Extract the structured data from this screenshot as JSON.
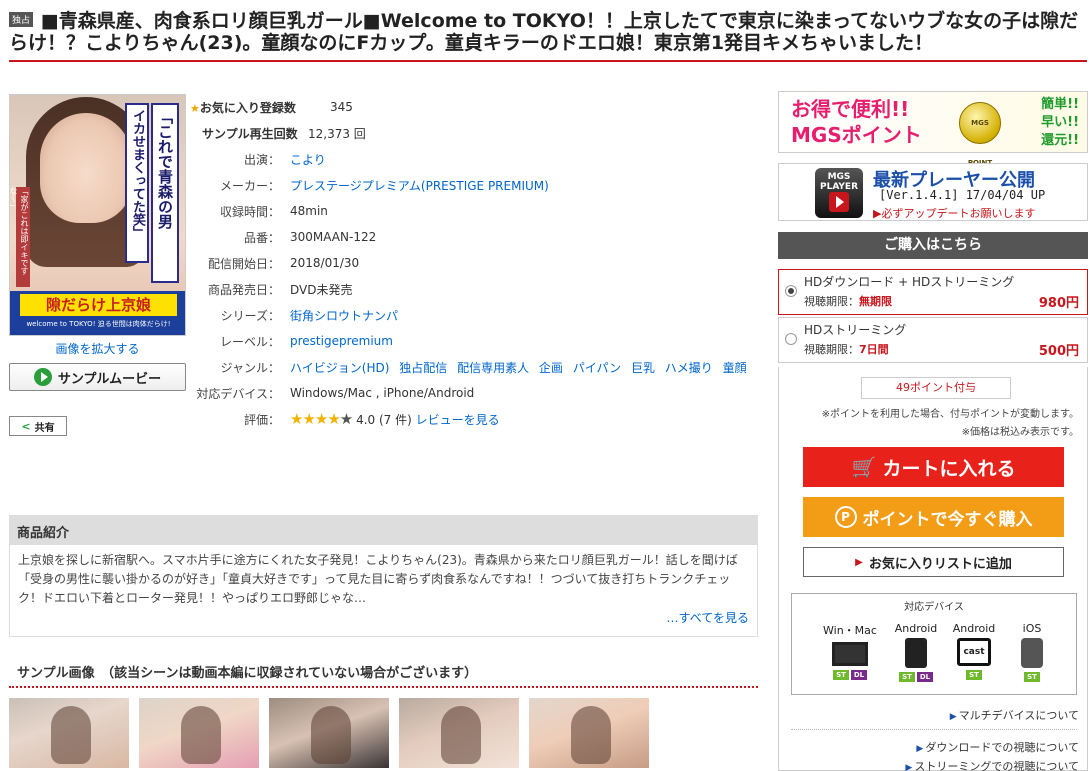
{
  "title": {
    "badge": "独占",
    "text": "■青森県産、肉食系ロリ顔巨乳ガール■Welcome to TOKYO！！上京したてで東京に染まってないウブな女の子は隙だらけ！？こよりちゃん(23)。童顔なのにFカップ。童貞キラーのドエロ娘！東京第1発目キメちゃいました！"
  },
  "cover": {
    "vertical_text_1": "「これで青森の男",
    "vertical_text_2": "イカせまくってた笑」",
    "side_text": "「家がこれは即イキですな〜」",
    "banner_big": "隙だらけ上京娘",
    "banner_small": "welcome to TOKYO! 迫る世間は肉体だらけ!"
  },
  "left": {
    "enlarge": "画像を拡大する",
    "sample_movie": "サンプルムービー",
    "share": "共有"
  },
  "info": {
    "favorites_label": "お気に入り登録数",
    "favorites_value": "345",
    "plays_label": "サンプル再生回数",
    "plays_value": "12,373 回",
    "rows": [
      {
        "label": "出演：",
        "value": "こより"
      },
      {
        "label": "メーカー：",
        "value": "プレステージプレミアム(PRESTIGE PREMIUM)"
      },
      {
        "label": "収録時間：",
        "value": "48min"
      },
      {
        "label": "品番：",
        "value": "300MAAN-122"
      },
      {
        "label": "配信開始日：",
        "value": "2018/01/30"
      },
      {
        "label": "商品発売日：",
        "value": "DVD未発売"
      },
      {
        "label": "シリーズ：",
        "value": "街角シロウトナンパ"
      },
      {
        "label": "レーベル：",
        "value": "prestigepremium"
      }
    ],
    "genre_label": "ジャンル：",
    "genres": [
      "ハイビジョン(HD)",
      "独占配信",
      "配信専用素人",
      "企画",
      "パイパン",
      "巨乳",
      "ハメ撮り",
      "童顔"
    ],
    "device_label": "対応デバイス：",
    "device_value": "Windows/Mac , iPhone/Android",
    "rating_label": "評価：",
    "rating_value": 4,
    "rating_text": "4.0 (7 件)",
    "review_link": "レビューを見る"
  },
  "intro": {
    "heading": "商品紹介",
    "body": "上京娘を探しに新宿駅へ。スマホ片手に途方にくれた女子発見！こよりちゃん(23)。青森県から来たロリ顔巨乳ガール！話しを聞けば「受身の男性に襲い掛かるのが好き」「童貞大好きです」って見た目に寄らず肉食系なんですね！！つづいて抜き打ちトランクチェック！ドエロい下着とローター発見！！やっぱりエロ野郎じゃな…",
    "more": "…すべてを見る"
  },
  "samples": {
    "heading": "サンプル画像　（該当シーンは動画本編に収録されていない場合がございます）"
  },
  "banners": {
    "points_main_1": "お得で便利!!",
    "points_main_2": "MGSポイント",
    "points_coin": "MGS POINT",
    "points_side_1": "簡単!!",
    "points_side_2": "早い!!",
    "points_side_3": "還元!!",
    "player_logo": "MGS PLAYER",
    "player_title": "最新プレーヤー公開",
    "player_version": "[Ver.1.4.1]  17/04/04 UP",
    "player_note": "▶必ずアップデートお願いします"
  },
  "purchase": {
    "heading": "ご購入はこちら",
    "options": [
      {
        "name": "HDダウンロード + HDストリーミング",
        "limit_label": "視聴期限：",
        "limit_value": "無期限",
        "price": "980円",
        "selected": true
      },
      {
        "name": "HDストリーミング",
        "limit_label": "視聴期限：",
        "limit_value": "7日間",
        "price": "500円",
        "selected": false
      }
    ],
    "points_badge": "49ポイント付与",
    "note1": "※ポイントを利用した場合、付与ポイントが変動します。",
    "note2": "※価格は税込み表示です。",
    "cart_button": "カートに入れる",
    "point_button": "ポイントで今すぐ購入",
    "favorite_button": "お気に入りリストに追加"
  },
  "devices": {
    "heading": "対応デバイス",
    "items": [
      {
        "name": "Win・Mac",
        "tags": [
          "ST",
          "DL"
        ]
      },
      {
        "name": "Android",
        "tags": [
          "ST",
          "DL"
        ]
      },
      {
        "name": "Android",
        "tags": [
          "ST"
        ],
        "cast": "cast"
      },
      {
        "name": "iOS",
        "tags": [
          "ST"
        ]
      }
    ]
  },
  "links": {
    "multi_device": "マルチデバイスについて",
    "download": "ダウンロードでの視聴について",
    "streaming": "ストリーミングでの視聴について"
  }
}
